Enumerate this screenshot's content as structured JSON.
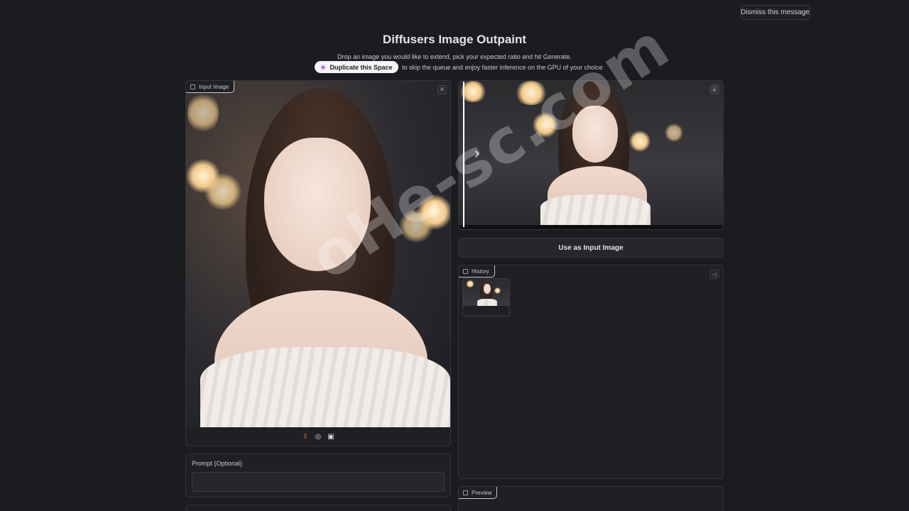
{
  "banner": {
    "dismiss_label": "Dismiss this message"
  },
  "header": {
    "title": "Diffusers Image Outpaint",
    "subtitle": "Drop an image you would like to extend, pick your expected ratio and hit Generate.",
    "duplicate_label": "Duplicate this Space",
    "duplicate_suffix": "to skip the queue and enjoy faster inference on the GPU of your choice"
  },
  "input_panel": {
    "label": "Input Image",
    "close_icon": "close-icon",
    "source_icons": [
      "upload-icon",
      "webcam-icon",
      "clipboard-icon"
    ]
  },
  "prompt": {
    "label": "Prompt (Optional)",
    "value": "",
    "placeholder": ""
  },
  "output_panel": {
    "download_icon": "download-icon",
    "compare_icon": "chevron-right-icon"
  },
  "use_as_input": {
    "label": "Use as Input Image"
  },
  "history": {
    "label": "History",
    "share_icon": "share-icon"
  },
  "preview": {
    "label": "Preview"
  },
  "watermark": {
    "text": "oHe-sc.com"
  },
  "colors": {
    "background": "#1b1c20",
    "panel": "#1f2024",
    "accent": "#f97316",
    "duplicate_dot": "#a855f7"
  }
}
